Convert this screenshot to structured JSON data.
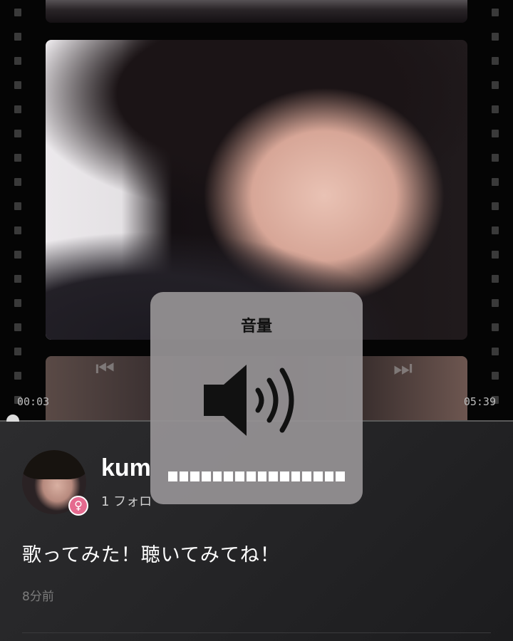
{
  "player": {
    "current_time": "00:03",
    "total_time": "05:39",
    "progress": 0.01
  },
  "icons": {
    "prev": "skip-previous-icon",
    "next": "skip-next-icon",
    "speaker": "speaker-volume-icon",
    "gender": "female-icon"
  },
  "post": {
    "username": "kum",
    "follow_info": "1 フォロ",
    "caption": "歌ってみた！聴いてみてね！",
    "time_ago": "8分前",
    "gender_symbol": "♀"
  },
  "volume_hud": {
    "title": "音量",
    "segments": 16,
    "level": 1.0
  },
  "colors": {
    "gender_badge": "#e56a8f",
    "panel_bg": "#2a2a2c"
  }
}
